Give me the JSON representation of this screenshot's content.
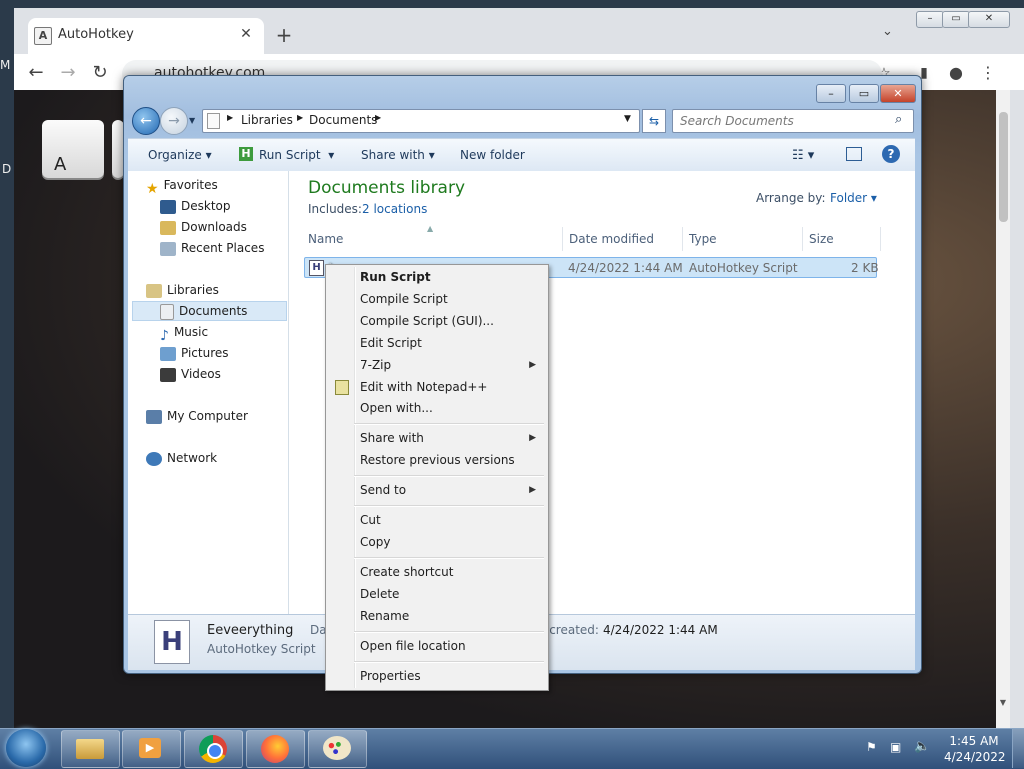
{
  "browser": {
    "tab_title": "AutoHotkey",
    "tab_favicon": "A",
    "address": "autohotkey.com",
    "keycap_letter": "A",
    "left_edge_letters": [
      "M",
      "D"
    ]
  },
  "explorer": {
    "breadcrumb": [
      "Libraries",
      "Documents"
    ],
    "search_placeholder": "Search Documents",
    "commands": {
      "organize": "Organize",
      "run_script": "Run Script",
      "share_with": "Share with",
      "new_folder": "New folder"
    },
    "nav": {
      "favorites": "Favorites",
      "desktop": "Desktop",
      "downloads": "Downloads",
      "recent_places": "Recent Places",
      "libraries": "Libraries",
      "documents": "Documents",
      "music": "Music",
      "pictures": "Pictures",
      "videos": "Videos",
      "my_computer": "My Computer",
      "network": "Network"
    },
    "library": {
      "title": "Documents library",
      "includes_label": "Includes:",
      "includes_link": "2 locations",
      "arrange_label": "Arrange by:",
      "arrange_value": "Folder"
    },
    "columns": {
      "name": "Name",
      "date": "Date modified",
      "type": "Type",
      "size": "Size"
    },
    "file": {
      "date": "4/24/2022 1:44 AM",
      "type": "AutoHotkey Script",
      "size": "2 KB"
    },
    "details": {
      "name": "Eeveerything",
      "type": "AutoHotkey Script",
      "left_label": "Dat",
      "created_label": "e created:",
      "created_value": "4/24/2022 1:44 AM"
    }
  },
  "context_menu": {
    "run_script": "Run Script",
    "compile_script": "Compile Script",
    "compile_script_gui": "Compile Script (GUI)...",
    "edit_script": "Edit Script",
    "seven_zip": "7-Zip",
    "edit_notepadpp": "Edit with Notepad++",
    "open_with": "Open with...",
    "share_with": "Share with",
    "restore_prev": "Restore previous versions",
    "send_to": "Send to",
    "cut": "Cut",
    "copy": "Copy",
    "create_shortcut": "Create shortcut",
    "delete": "Delete",
    "rename": "Rename",
    "open_file_location": "Open file location",
    "properties": "Properties"
  },
  "taskbar": {
    "time": "1:45 AM",
    "date": "4/24/2022"
  },
  "colors": {
    "library_title": "#1e7a1e",
    "link": "#1b5fa8",
    "selection": "#cce4f7"
  }
}
